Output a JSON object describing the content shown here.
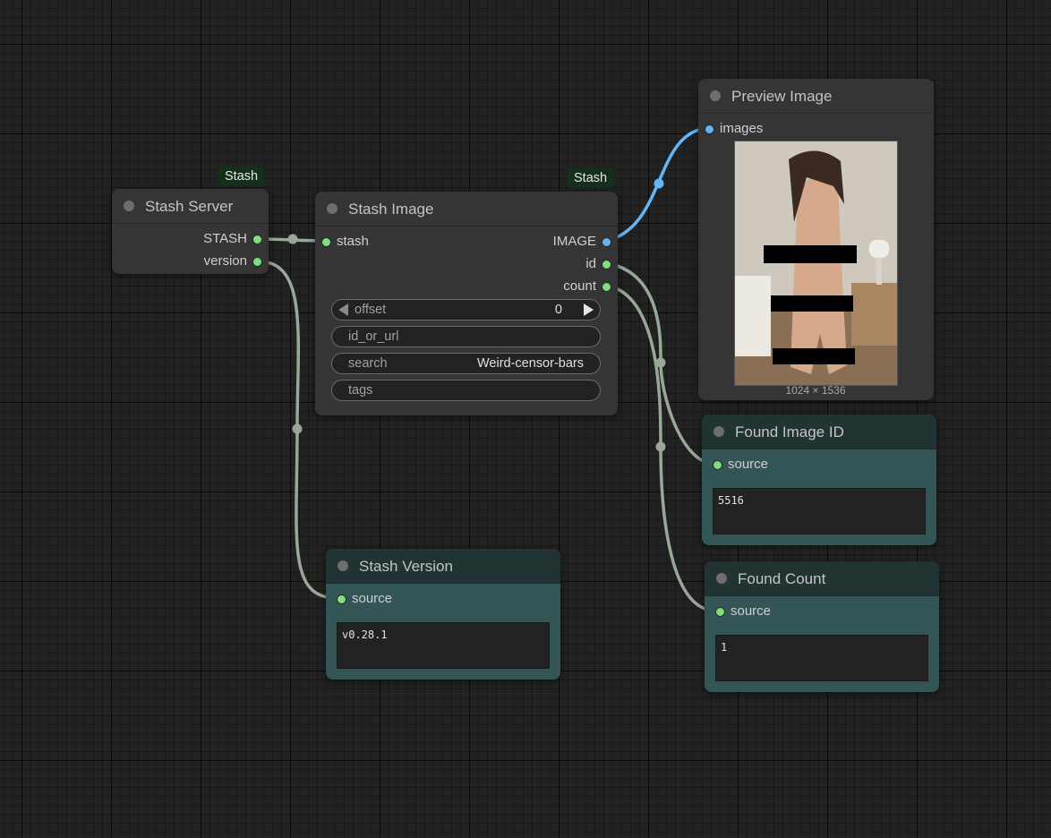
{
  "colors": {
    "canvas_bg": "#222222",
    "node_bg": "#353535",
    "teal_node_bg": "#335555",
    "teal_title_bg": "#223333",
    "link_green": "#98a898",
    "link_image_blue": "#64b5f6",
    "slot_green": "#7de07d",
    "badge_bg": "#15301a"
  },
  "nodes": {
    "stash_server": {
      "badge": "Stash",
      "title": "Stash Server",
      "outputs": [
        "STASH",
        "version"
      ]
    },
    "stash_image": {
      "badge": "Stash",
      "title": "Stash Image",
      "inputs": [
        "stash"
      ],
      "outputs": [
        "IMAGE",
        "id",
        "count"
      ],
      "widgets": {
        "offset": {
          "label": "offset",
          "value": "0"
        },
        "id_or_url": {
          "label": "id_or_url",
          "value": ""
        },
        "search": {
          "label": "search",
          "value": "Weird-censor-bars"
        },
        "tags": {
          "label": "tags",
          "value": ""
        }
      }
    },
    "preview_image": {
      "title": "Preview Image",
      "inputs": [
        "images"
      ],
      "image_alt": "Preview of generated image",
      "dimensions": "1024 × 1536"
    },
    "found_image_id": {
      "title": "Found Image ID",
      "inputs": [
        "source"
      ],
      "text": "5516"
    },
    "stash_version": {
      "title": "Stash Version",
      "inputs": [
        "source"
      ],
      "text": "v0.28.1"
    },
    "found_count": {
      "title": "Found Count",
      "inputs": [
        "source"
      ],
      "text": "1"
    }
  }
}
